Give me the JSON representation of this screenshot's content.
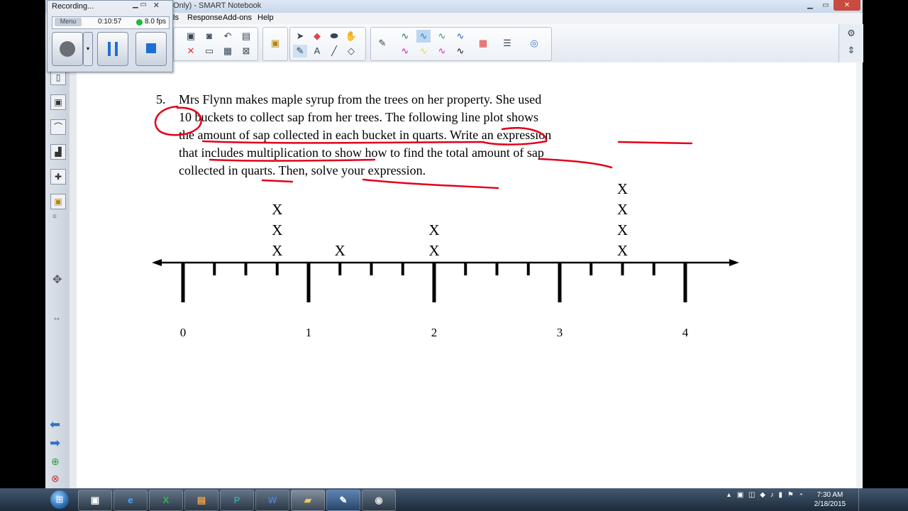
{
  "recorder": {
    "title": "Recording...",
    "time": "0:10:57",
    "fps": "8.0 fps",
    "menu_label": "Menu"
  },
  "window": {
    "title": "Only) - SMART Notebook",
    "menus": [
      "ls",
      "Response",
      "Add-ons",
      "Help"
    ]
  },
  "problem": {
    "number": "5.",
    "lines": [
      "Mrs Flynn makes maple syrup from the trees on her property. She used",
      "10 buckets to collect sap from her trees. The following  line plot shows",
      "the amount of sap collected in each bucket in quarts.  Write an expression",
      "that includes multiplication to show how to find the total amount of sap",
      "collected in quarts.  Then, solve your expression."
    ]
  },
  "lineplot": {
    "labels": [
      "0",
      "1",
      "2",
      "3",
      "4"
    ],
    "marker": "X",
    "stacks": [
      {
        "value": 0.75,
        "count": 3
      },
      {
        "value": 1.25,
        "count": 1
      },
      {
        "value": 2,
        "count": 2
      },
      {
        "value": 3.5,
        "count": 4
      }
    ]
  },
  "taskbar": {
    "apps": [
      "start-icon",
      "skype-icon",
      "internet-explorer-icon",
      "excel-icon",
      "paint-icon",
      "publisher-icon",
      "word-icon",
      "folder-icon",
      "smart-notebook-icon",
      "recorder-icon"
    ],
    "clock_time": "7:30 AM",
    "clock_date": "2/18/2015"
  },
  "colors": {
    "annotation_ink": "#e3001b",
    "taskbar": "#2b3a4d",
    "toolbar": "#eef2f7"
  }
}
